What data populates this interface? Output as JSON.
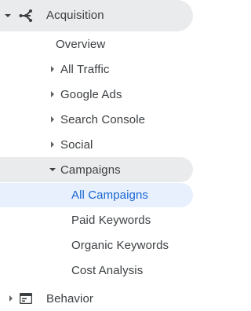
{
  "nav": {
    "acquisition": {
      "label": "Acquisition",
      "icon": "acquisition-icon",
      "expanded": true,
      "children": {
        "overview": {
          "label": "Overview"
        },
        "all_traffic": {
          "label": "All Traffic"
        },
        "google_ads": {
          "label": "Google Ads"
        },
        "search_console": {
          "label": "Search Console"
        },
        "social": {
          "label": "Social"
        },
        "campaigns": {
          "label": "Campaigns",
          "expanded": true,
          "children": {
            "all_campaigns": {
              "label": "All Campaigns",
              "selected": true
            },
            "paid_keywords": {
              "label": "Paid Keywords"
            },
            "organic_keywords": {
              "label": "Organic Keywords"
            },
            "cost_analysis": {
              "label": "Cost Analysis"
            }
          }
        }
      }
    },
    "behavior": {
      "label": "Behavior",
      "icon": "behavior-icon",
      "expanded": false
    }
  },
  "colors": {
    "active_section_bg": "#eaebec",
    "selected_item_bg": "#e8f0fe",
    "selected_item_text": "#1967d2",
    "text": "#3c4043",
    "icon": "#5f6368"
  }
}
